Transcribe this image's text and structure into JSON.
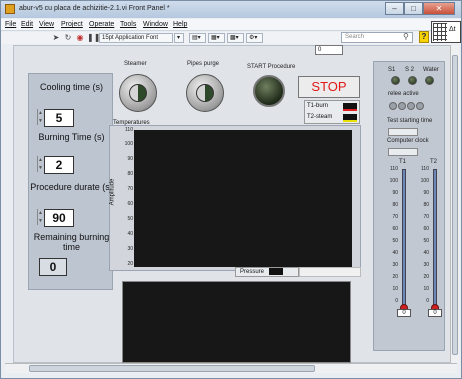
{
  "window": {
    "title": "abur-v5 cu placa de achizitie-2.1.vi Front Panel *",
    "controls": [
      "–",
      "□",
      "✕"
    ]
  },
  "menu": [
    "File",
    "Edit",
    "View",
    "Project",
    "Operate",
    "Tools",
    "Window",
    "Help"
  ],
  "toolbar": {
    "font": "15pt Application Font",
    "search_placeholder": "Search",
    "connector_label": "Δt",
    "top_indicator": "0"
  },
  "left_controls": {
    "cooling_label": "Cooling time (s)",
    "cooling_value": "5",
    "burning_label": "Burning Time (s)",
    "burning_value": "2",
    "procedure_label": "Procedure durate (s)",
    "procedure_value": "90",
    "remaining_label": "Remaining burning time",
    "remaining_value": "0"
  },
  "center_controls": {
    "steamer": "Steamer",
    "pipes": "Pipes purge",
    "start": "START Procedure",
    "stop": "STOP",
    "legend": [
      "T1-burn",
      "T2-steam"
    ]
  },
  "graph": {
    "title": "Temperatures",
    "ylabel": "Amplitude",
    "yticks": [
      "110",
      "100",
      "90",
      "80",
      "70",
      "60",
      "50",
      "40",
      "30",
      "20"
    ],
    "legend": "Pressure"
  },
  "right_panel": {
    "leds": [
      "S1",
      "S 2",
      "Water"
    ],
    "relay": "relee active",
    "test_time": "Test starting time",
    "clock": "Computer clock",
    "t1": "T1",
    "t2": "T2",
    "scale": [
      "110",
      "100",
      "90",
      "80",
      "70",
      "60",
      "50",
      "40",
      "30",
      "20",
      "10",
      "0"
    ],
    "t1_value": "0",
    "t2_value": "0"
  }
}
